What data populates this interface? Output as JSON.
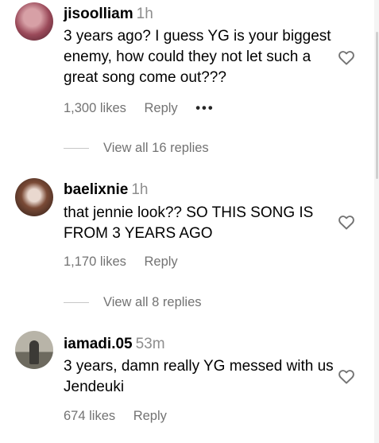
{
  "comments": [
    {
      "username": "jisoolliam",
      "time": "1h",
      "text": "3 years ago? I guess YG is your biggest enemy, how could they not let such a great song come out???",
      "likes": "1,300 likes",
      "reply_label": "Reply",
      "more_label": "•••",
      "view_replies": "View all 16 replies"
    },
    {
      "username": "baelixnie",
      "time": "1h",
      "text": "that jennie look?? SO THIS SONG IS FROM 3 YEARS AGO",
      "likes": "1,170 likes",
      "reply_label": "Reply",
      "view_replies": "View all 8 replies"
    },
    {
      "username": "iamadi.05",
      "time": "53m",
      "text": "3 years, damn really YG messed with us Jendeuki",
      "likes": "674 likes",
      "reply_label": "Reply"
    }
  ],
  "icons": {
    "like": "heart-outline-icon",
    "more": "more-options-icon"
  },
  "colors": {
    "secondary_text": "#737373",
    "time_text": "#8e8e8e",
    "divider": "#c7c7c7"
  }
}
